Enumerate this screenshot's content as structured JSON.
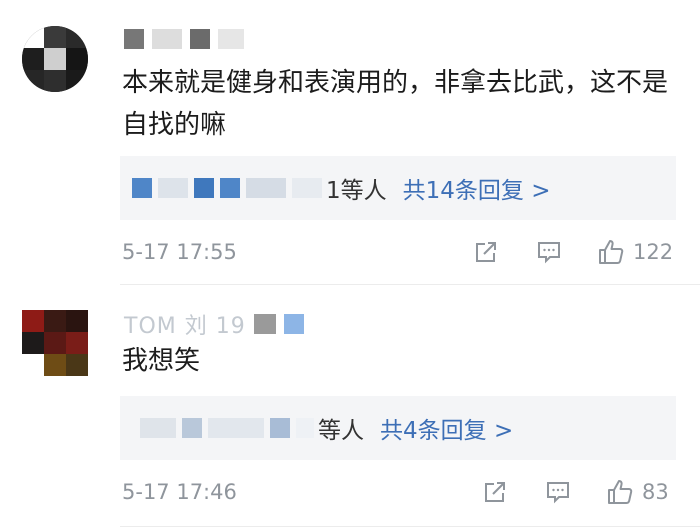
{
  "comments": [
    {
      "username": "▪ ▪ ▪",
      "text": "本来就是健身和表演用的，非拿去比武，这不是自找的嘛",
      "reply_summary": {
        "who_suffix": "1等人",
        "link": "共14条回复 >"
      },
      "time": "5-17 17:55",
      "likes": "122"
    },
    {
      "username": "TOM 刘 19",
      "text": "我想笑",
      "reply_summary": {
        "who_suffix": "等人",
        "link": "共4条回复 >"
      },
      "time": "5-17 17:46",
      "likes": "83"
    }
  ],
  "colors": {
    "link": "#3d6fb6",
    "muted": "#8f959c",
    "reply_bg": "#f4f5f7",
    "text": "#1c1c1c"
  },
  "icons": [
    "share-icon",
    "comment-icon",
    "like-icon"
  ]
}
